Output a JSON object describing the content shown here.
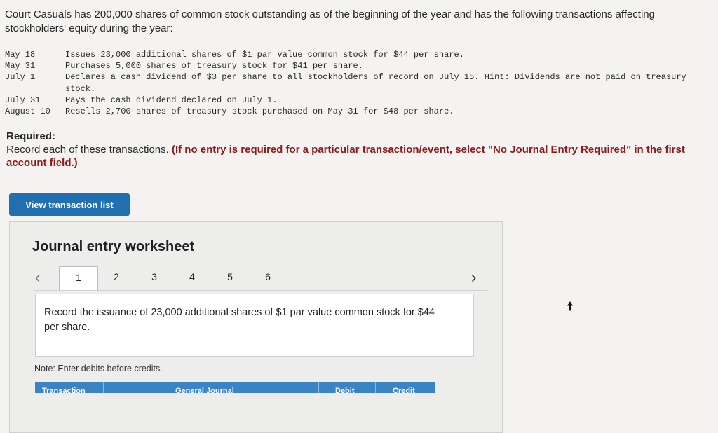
{
  "intro": "Court Casuals has 200,000 shares of common stock outstanding as of the beginning of the year and has the following transactions affecting stockholders' equity during the year:",
  "transactions": [
    {
      "date": "May 18",
      "desc": "Issues 23,000 additional shares of $1 par value common stock for $44 per share."
    },
    {
      "date": "May 31",
      "desc": "Purchases 5,000 shares of treasury stock for $41 per share."
    },
    {
      "date": "July 1",
      "desc": "Declares a cash dividend of $3 per share to all stockholders of record on July 15. Hint: Dividends are not paid on treasury stock."
    },
    {
      "date": "July 31",
      "desc": "Pays the cash dividend declared on July 1."
    },
    {
      "date": "August 10",
      "desc": "Resells 2,700 shares of treasury stock purchased on May 31 for $48 per share."
    }
  ],
  "required": {
    "heading": "Required:",
    "text": "Record each of these transactions.",
    "instruction": "(If no entry is required for a particular transaction/event, select \"No Journal Entry Required\" in the first account field.)"
  },
  "view_button": "View transaction list",
  "worksheet": {
    "title": "Journal entry worksheet",
    "tabs": [
      "1",
      "2",
      "3",
      "4",
      "5",
      "6"
    ],
    "active_tab": "1",
    "prev_icon": "chevron-left-icon",
    "next_icon": "chevron-right-icon",
    "prompt": "Record the issuance of 23,000 additional shares of $1 par value common stock for $44 per share.",
    "note": "Note: Enter debits before credits.",
    "columns": [
      "Transaction",
      "General Journal",
      "Debit",
      "Credit"
    ]
  },
  "colors": {
    "button_blue": "#1f6fb1",
    "instruction_red": "#8a1c1c",
    "table_header_blue": "#3a83c4"
  }
}
